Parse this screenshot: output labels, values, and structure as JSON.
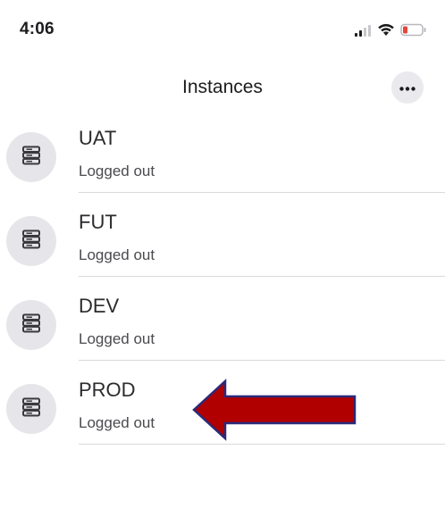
{
  "status_bar": {
    "time": "4:06",
    "icons": [
      "cellular-signal-icon",
      "wifi-icon",
      "battery-low-icon"
    ]
  },
  "nav": {
    "title": "Instances",
    "more_icon": "ellipsis-icon"
  },
  "instances": [
    {
      "name": "UAT",
      "status": "Logged out",
      "icon": "server-icon"
    },
    {
      "name": "FUT",
      "status": "Logged out",
      "icon": "server-icon"
    },
    {
      "name": "DEV",
      "status": "Logged out",
      "icon": "server-icon"
    },
    {
      "name": "PROD",
      "status": "Logged out",
      "icon": "server-icon"
    }
  ],
  "annotation": {
    "arrow_color": "#b00000",
    "arrow_border": "#2a2a7a",
    "points_to": "PROD"
  },
  "colors": {
    "battery_low": "#e5453a",
    "avatar_bg": "#e6e6ea",
    "divider": "#d9d9de"
  }
}
